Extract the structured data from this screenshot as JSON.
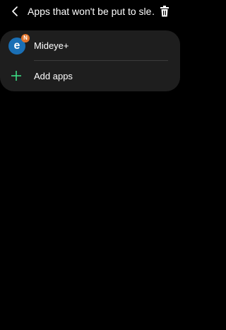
{
  "header": {
    "title": "Apps that won't be put to sle…",
    "back_icon": "back-arrow-icon",
    "delete_icon": "trash-icon"
  },
  "list": {
    "apps": [
      {
        "name": "Mideye+",
        "icon": "mideye-app-icon",
        "badge": "N",
        "icon_letter": "e"
      }
    ],
    "add_label": "Add apps",
    "add_icon": "plus-icon"
  },
  "colors": {
    "background": "#000000",
    "card": "#1e1e1e",
    "accent_green": "#3ddc84",
    "badge_orange": "#e0732a",
    "app_icon_blue": "#1a6fb5"
  }
}
